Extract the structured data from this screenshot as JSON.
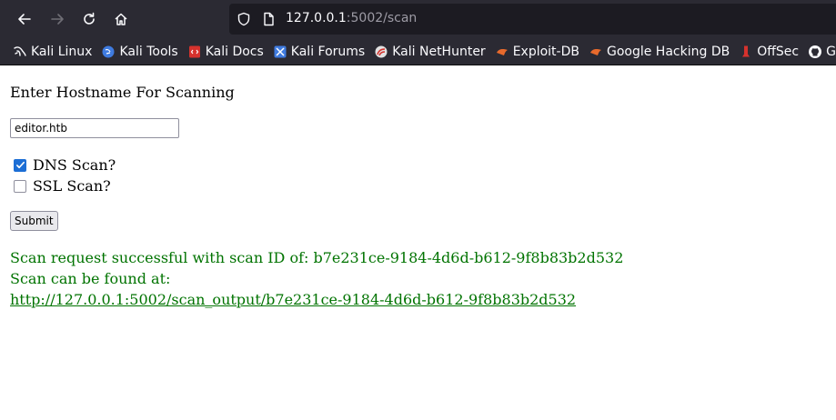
{
  "browser": {
    "url_host": "127.0.0.1",
    "url_path": ":5002/scan"
  },
  "bookmarks": [
    {
      "label": "Kali Linux",
      "icon": "kali-dragon-icon"
    },
    {
      "label": "Kali Tools",
      "icon": "kali-tools-icon"
    },
    {
      "label": "Kali Docs",
      "icon": "kali-docs-icon"
    },
    {
      "label": "Kali Forums",
      "icon": "kali-forums-icon"
    },
    {
      "label": "Kali NetHunter",
      "icon": "nethunter-icon"
    },
    {
      "label": "Exploit-DB",
      "icon": "exploit-db-icon"
    },
    {
      "label": "Google Hacking DB",
      "icon": "ghdb-icon"
    },
    {
      "label": "OffSec",
      "icon": "offsec-icon"
    },
    {
      "label": "GitH",
      "icon": "github-icon"
    }
  ],
  "form": {
    "heading": "Enter Hostname For Scanning",
    "hostname_value": "editor.htb",
    "dns_label": "DNS Scan?",
    "dns_checked": true,
    "ssl_label": "SSL Scan?",
    "ssl_checked": false,
    "submit_label": "Submit"
  },
  "result": {
    "line1": "Scan request successful with scan ID of: b7e231ce-9184-4d6d-b612-9f8b83b2d532",
    "line2": "Scan can be found at:",
    "link": "http://127.0.0.1:5002/scan_output/b7e231ce-9184-4d6d-b612-9f8b83b2d532",
    "color": "#007300"
  }
}
